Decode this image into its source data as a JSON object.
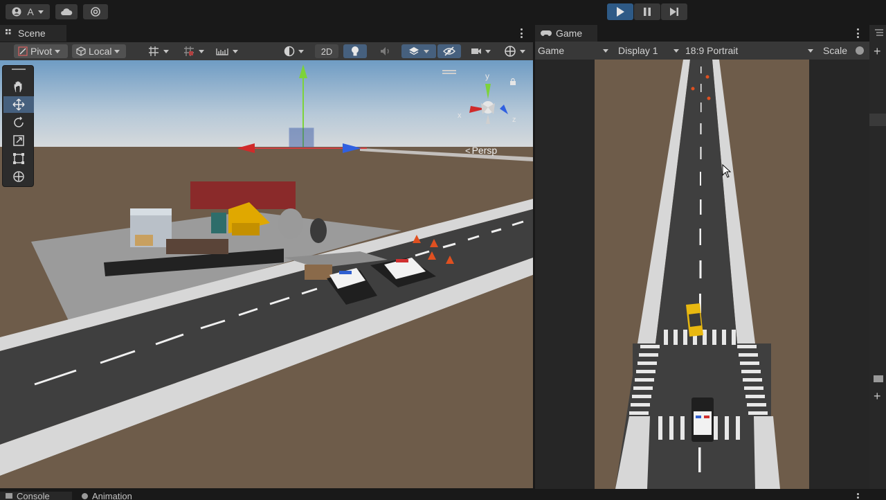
{
  "toolbar": {
    "account_label": "A",
    "icons": [
      "account-icon",
      "cloud-icon",
      "collab-icon"
    ],
    "play_controls": [
      "play-icon",
      "pause-icon",
      "step-icon"
    ]
  },
  "scene": {
    "tab_label": "Scene",
    "pivot_label": "Pivot",
    "space_label": "Local",
    "mode_2d_label": "2D",
    "persp_label": "Persp",
    "gizmo_axes": {
      "y": "y",
      "x": "x",
      "z": "z"
    },
    "tools": [
      "hand-tool-icon",
      "move-tool-icon",
      "rotate-tool-icon",
      "scale-tool-icon",
      "rect-tool-icon",
      "transform-tool-icon"
    ]
  },
  "game": {
    "tab_label": "Game",
    "view_label": "Game",
    "display_label": "Display 1",
    "aspect_label": "18:9 Portrait",
    "scale_label": "Scale"
  },
  "bottom": {
    "tabs": [
      "Console",
      "Animation"
    ]
  },
  "colors": {
    "play_active": "#2e5a86",
    "sky_top": "#7fa8c8",
    "ground": "#6e5c4a",
    "road": "#3f3f3f",
    "sidewalk": "#d6d6d6"
  }
}
